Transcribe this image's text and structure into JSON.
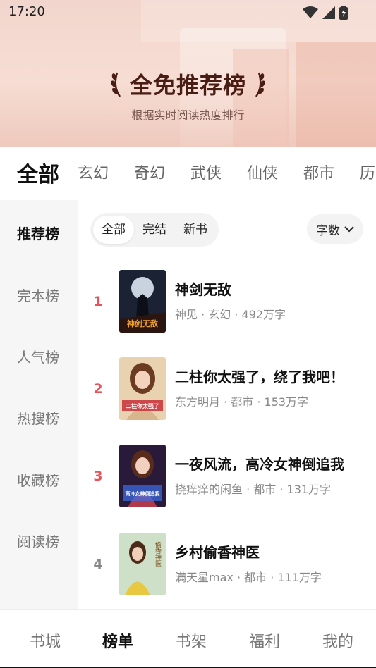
{
  "status": {
    "time": "17:20"
  },
  "hero": {
    "title": "全免推荐榜",
    "subtitle": "根据实时阅读热度排行"
  },
  "categories": [
    "全部",
    "玄幻",
    "奇幻",
    "武侠",
    "仙侠",
    "都市",
    "历"
  ],
  "rank_tabs": [
    "推荐榜",
    "完本榜",
    "人气榜",
    "热搜榜",
    "收藏榜",
    "阅读榜"
  ],
  "filter": {
    "segments": [
      "全部",
      "完结",
      "新书"
    ],
    "sort_label": "字数"
  },
  "books": [
    {
      "rank": "1",
      "title": "神剑无敌",
      "meta": "神见 · 玄幻 · 492万字",
      "cover_text": "神剑无敌"
    },
    {
      "rank": "2",
      "title": "二柱你太强了，绕了我吧！",
      "meta": "东方明月 · 都市 · 153万字",
      "cover_text": "二柱你太强了"
    },
    {
      "rank": "3",
      "title": "一夜风流，高冷女神倒追我",
      "meta": "挠痒痒的闲鱼 · 都市 · 131万字",
      "cover_text": "高冷女神倒追我"
    },
    {
      "rank": "4",
      "title": "乡村偷香神医",
      "meta": "满天星max · 都市 · 111万字",
      "cover_text": "偷香神医"
    }
  ],
  "bottom_nav": [
    "书城",
    "榜单",
    "书架",
    "福利",
    "我的"
  ],
  "colors": {
    "rank_top": "#e8535a",
    "rank_other": "#888888",
    "hero_title": "#4a1d14"
  }
}
